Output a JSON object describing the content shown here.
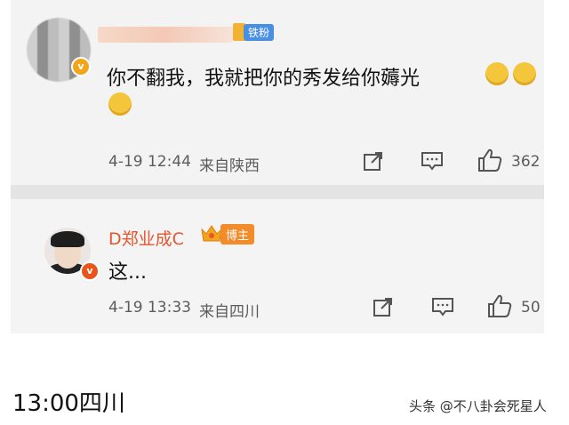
{
  "comment1": {
    "fan_tag": "铁粉",
    "verified_mark": "v",
    "text": "你不翻我，我就把你的秀发给你薅光",
    "time": "4-19 12:44",
    "location": "来自陕西",
    "likes": "362",
    "icons": [
      "share-icon",
      "comment-icon",
      "like-icon"
    ]
  },
  "comment2": {
    "username": "D郑业成C",
    "blogger_tag": "博主",
    "verified_mark": "v",
    "text": "这...",
    "time": "4-19 13:33",
    "location": "来自四川",
    "likes": "50",
    "icons": [
      "share-icon",
      "comment-icon",
      "like-icon"
    ]
  },
  "caption": "13:00四川",
  "watermark": "头条 @不八卦会死星人",
  "colors": {
    "username_accent": "#e3562f",
    "fan_tag": "#4a90e2",
    "blogger_tag": "#f28c2a",
    "background": "#f3f3f3"
  }
}
